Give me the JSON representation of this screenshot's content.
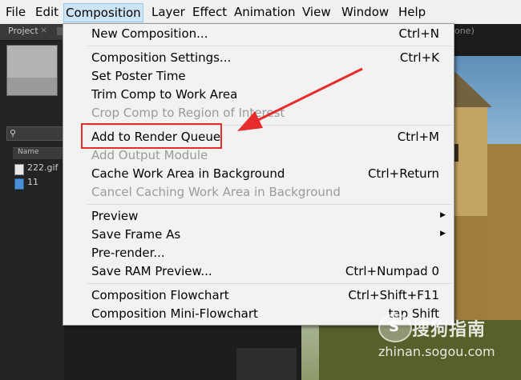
{
  "menubar": {
    "items": [
      "File",
      "Edit",
      "Composition",
      "Layer",
      "Effect",
      "Animation",
      "View",
      "Window",
      "Help"
    ],
    "active": "Composition"
  },
  "project_panel": {
    "tab_label": "Project",
    "tab_close": "×",
    "column_name": "Name",
    "files": [
      {
        "name": "222.gif",
        "icon": "image-file-icon"
      },
      {
        "name": "11",
        "icon": "composition-icon"
      }
    ]
  },
  "viewer": {
    "tab_fragment": "none)"
  },
  "composition_menu": {
    "groups": [
      [
        {
          "label": "New Composition...",
          "shortcut": "Ctrl+N",
          "enabled": true
        }
      ],
      [
        {
          "label": "Composition Settings...",
          "shortcut": "Ctrl+K",
          "enabled": true
        },
        {
          "label": "Set Poster Time",
          "shortcut": "",
          "enabled": true
        },
        {
          "label": "Trim Comp to Work Area",
          "shortcut": "",
          "enabled": true
        },
        {
          "label": "Crop Comp to Region of Interest",
          "shortcut": "",
          "enabled": false
        }
      ],
      [
        {
          "label": "Add to Render Queue",
          "shortcut": "Ctrl+M",
          "enabled": true,
          "highlighted": true
        },
        {
          "label": "Add Output Module",
          "shortcut": "",
          "enabled": false
        },
        {
          "label": "Cache Work Area in Background",
          "shortcut": "Ctrl+Return",
          "enabled": true
        },
        {
          "label": "Cancel Caching Work Area in Background",
          "shortcut": "",
          "enabled": false
        }
      ],
      [
        {
          "label": "Preview",
          "shortcut": "",
          "enabled": true,
          "submenu": true
        },
        {
          "label": "Save Frame As",
          "shortcut": "",
          "enabled": true,
          "submenu": true
        },
        {
          "label": "Pre-render...",
          "shortcut": "",
          "enabled": true
        },
        {
          "label": "Save RAM Preview...",
          "shortcut": "Ctrl+Numpad 0",
          "enabled": true
        }
      ],
      [
        {
          "label": "Composition Flowchart",
          "shortcut": "Ctrl+Shift+F11",
          "enabled": true
        },
        {
          "label": "Composition Mini-Flowchart",
          "shortcut": "tap Shift",
          "enabled": true
        }
      ]
    ]
  },
  "annotation": {
    "highlight_color": "#e82c2c",
    "target": "Add to Render Queue"
  },
  "watermark": {
    "logo_glyph": "S",
    "title": "搜狗指南",
    "url": "zhinan.sogou.com"
  }
}
